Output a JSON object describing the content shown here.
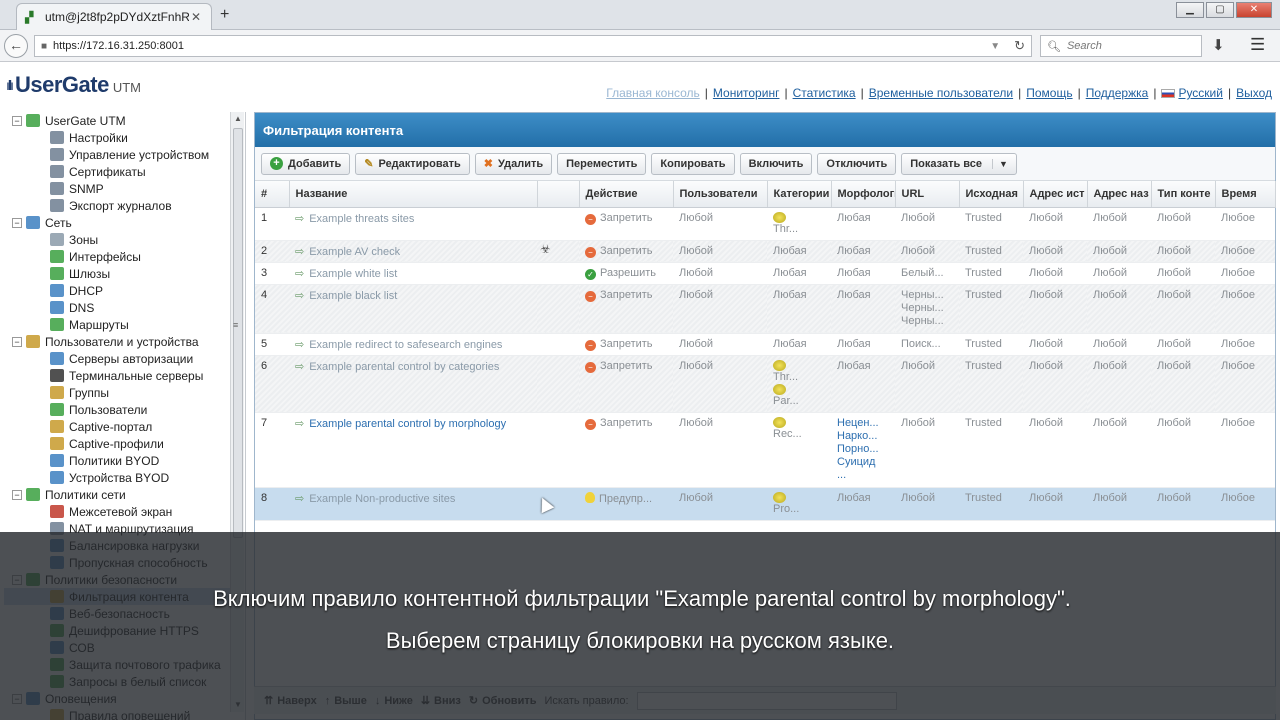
{
  "browser": {
    "tab_title": "utm@j2t8fp2pDYdXztFnhR...",
    "new_tab": "+",
    "url": "https://172.16.31.250:8001",
    "search_placeholder": "Search"
  },
  "app": {
    "brand": "UserGate",
    "brand_sub": "UTM",
    "top_links": [
      "Главная консоль",
      "Мониторинг",
      "Статистика",
      "Временные пользователи",
      "Помощь",
      "Поддержка",
      "Русский",
      "Выход"
    ]
  },
  "sidebar": {
    "items": [
      {
        "label": "UserGate UTM",
        "level": 0,
        "icon": "ug-icon",
        "color": "#3aa040"
      },
      {
        "label": "Настройки",
        "level": 1,
        "icon": "settings-icon",
        "color": "#6d7e90"
      },
      {
        "label": "Управление устройством",
        "level": 1,
        "icon": "device-icon",
        "color": "#6d7e90"
      },
      {
        "label": "Сертификаты",
        "level": 1,
        "icon": "certificate-icon",
        "color": "#6d7e90"
      },
      {
        "label": "SNMP",
        "level": 1,
        "icon": "snmp-icon",
        "color": "#6d7e90"
      },
      {
        "label": "Экспорт журналов",
        "level": 1,
        "icon": "export-icon",
        "color": "#6d7e90"
      },
      {
        "label": "Сеть",
        "level": 0,
        "icon": "network-icon",
        "color": "#3c7fc0"
      },
      {
        "label": "Зоны",
        "level": 1,
        "icon": "zones-icon",
        "color": "#8a9aa8"
      },
      {
        "label": "Интерфейсы",
        "level": 1,
        "icon": "interfaces-icon",
        "color": "#3aa040"
      },
      {
        "label": "Шлюзы",
        "level": 1,
        "icon": "gateways-icon",
        "color": "#3aa040"
      },
      {
        "label": "DHCP",
        "level": 1,
        "icon": "dhcp-icon",
        "color": "#3c7fc0"
      },
      {
        "label": "DNS",
        "level": 1,
        "icon": "dns-icon",
        "color": "#3c7fc0"
      },
      {
        "label": "Маршруты",
        "level": 1,
        "icon": "routes-icon",
        "color": "#3aa040"
      },
      {
        "label": "Пользователи и устройства",
        "level": 0,
        "icon": "users-devices-icon",
        "color": "#c79a2b"
      },
      {
        "label": "Серверы авторизации",
        "level": 1,
        "icon": "auth-servers-icon",
        "color": "#3c7fc0"
      },
      {
        "label": "Терминальные серверы",
        "level": 1,
        "icon": "terminal-servers-icon",
        "color": "#333333"
      },
      {
        "label": "Группы",
        "level": 1,
        "icon": "groups-icon",
        "color": "#c79a2b"
      },
      {
        "label": "Пользователи",
        "level": 1,
        "icon": "users-icon",
        "color": "#3aa040"
      },
      {
        "label": "Captive-портал",
        "level": 1,
        "icon": "captive-portal-icon",
        "color": "#c79a2b"
      },
      {
        "label": "Captive-профили",
        "level": 1,
        "icon": "captive-profiles-icon",
        "color": "#c79a2b"
      },
      {
        "label": "Политики BYOD",
        "level": 1,
        "icon": "byod-policies-icon",
        "color": "#3c7fc0"
      },
      {
        "label": "Устройства BYOD",
        "level": 1,
        "icon": "byod-devices-icon",
        "color": "#3c7fc0"
      },
      {
        "label": "Политики сети",
        "level": 0,
        "icon": "network-policies-icon",
        "color": "#3aa040"
      },
      {
        "label": "Межсетевой экран",
        "level": 1,
        "icon": "firewall-icon",
        "color": "#c0392b"
      },
      {
        "label": "NAT и маршрутизация",
        "level": 1,
        "icon": "nat-icon",
        "color": "#6d7e90"
      },
      {
        "label": "Балансировка нагрузки",
        "level": 1,
        "icon": "load-balancing-icon",
        "color": "#3c7fc0"
      },
      {
        "label": "Пропускная способность",
        "level": 1,
        "icon": "bandwidth-icon",
        "color": "#3c7fc0"
      },
      {
        "label": "Политики безопасности",
        "level": 0,
        "icon": "security-policies-icon",
        "color": "#3aa040"
      },
      {
        "label": "Фильтрация контента",
        "level": 1,
        "icon": "content-filter-icon",
        "color": "#c79a2b",
        "selected": true
      },
      {
        "label": "Веб-безопасность",
        "level": 1,
        "icon": "web-security-icon",
        "color": "#3c7fc0"
      },
      {
        "label": "Дешифрование HTTPS",
        "level": 1,
        "icon": "https-icon",
        "color": "#3aa040"
      },
      {
        "label": "СОВ",
        "level": 1,
        "icon": "ids-icon",
        "color": "#3c7fc0"
      },
      {
        "label": "Защита почтового трафика",
        "level": 1,
        "icon": "mail-protection-icon",
        "color": "#3aa040"
      },
      {
        "label": "Запросы в белый список",
        "level": 1,
        "icon": "whitelist-requests-icon",
        "color": "#3aa040"
      },
      {
        "label": "Оповещения",
        "level": 0,
        "icon": "notifications-icon",
        "color": "#3c7fc0"
      },
      {
        "label": "Правила оповещений",
        "level": 1,
        "icon": "alert-rules-icon",
        "color": "#c79a2b"
      }
    ]
  },
  "panel": {
    "title": "Фильтрация контента",
    "toolbar": [
      {
        "label": "Добавить",
        "icon": "+"
      },
      {
        "label": "Редактировать",
        "icon": "✎"
      },
      {
        "label": "Удалить",
        "icon": "✖"
      },
      {
        "label": "Переместить",
        "icon": ""
      },
      {
        "label": "Копировать",
        "icon": ""
      },
      {
        "label": "Включить",
        "icon": ""
      },
      {
        "label": "Отключить",
        "icon": ""
      },
      {
        "label": "Показать все",
        "icon": "",
        "dropdown": true
      }
    ],
    "columns": [
      "#",
      "Название",
      "",
      "Действие",
      "Пользователи",
      "Категории",
      "Морфология",
      "URL",
      "Исходная",
      "Адрес ист",
      "Адрес наз",
      "Тип конте",
      "Время"
    ],
    "rows": [
      {
        "num": "1",
        "name": "Example threats sites",
        "action": "Запретить",
        "action_type": "deny",
        "users": "Любой",
        "categories": [
          "Thr..."
        ],
        "morph": [
          "Любая"
        ],
        "url": [
          "Любой"
        ],
        "src": "Trusted",
        "src_addr": "Любой",
        "dst_addr": "Любой",
        "ctype": "Любой",
        "time": "Любое"
      },
      {
        "num": "2",
        "name": "Example AV check",
        "action": "Запретить",
        "action_type": "deny",
        "users": "Любой",
        "categories": [
          "Любая"
        ],
        "morph": [
          "Любая"
        ],
        "url": [
          "Любой"
        ],
        "src": "Trusted",
        "src_addr": "Любой",
        "dst_addr": "Любой",
        "ctype": "Любой",
        "time": "Любое"
      },
      {
        "num": "3",
        "name": "Example white list",
        "action": "Разрешить",
        "action_type": "allow",
        "users": "Любой",
        "categories": [
          "Любая"
        ],
        "morph": [
          "Любая"
        ],
        "url": [
          "Белый..."
        ],
        "src": "Trusted",
        "src_addr": "Любой",
        "dst_addr": "Любой",
        "ctype": "Любой",
        "time": "Любое"
      },
      {
        "num": "4",
        "name": "Example black list",
        "action": "Запретить",
        "action_type": "deny",
        "users": "Любой",
        "categories": [
          "Любая"
        ],
        "morph": [
          "Любая"
        ],
        "url": [
          "Черны...",
          "Черны...",
          "Черны..."
        ],
        "src": "Trusted",
        "src_addr": "Любой",
        "dst_addr": "Любой",
        "ctype": "Любой",
        "time": "Любое"
      },
      {
        "num": "5",
        "name": "Example redirect to safesearch engines",
        "action": "Запретить",
        "action_type": "deny",
        "users": "Любой",
        "categories": [
          "Любая"
        ],
        "morph": [
          "Любая"
        ],
        "url": [
          "Поиск..."
        ],
        "src": "Trusted",
        "src_addr": "Любой",
        "dst_addr": "Любой",
        "ctype": "Любой",
        "time": "Любое"
      },
      {
        "num": "6",
        "name": "Example parental control by categories",
        "action": "Запретить",
        "action_type": "deny",
        "users": "Любой",
        "categories": [
          "Thr...",
          "Par..."
        ],
        "morph": [
          "Любая"
        ],
        "url": [
          "Любой"
        ],
        "src": "Trusted",
        "src_addr": "Любой",
        "dst_addr": "Любой",
        "ctype": "Любой",
        "time": "Любое"
      },
      {
        "num": "7",
        "name": "Example parental control by morphology",
        "action": "Запретить",
        "action_type": "deny",
        "users": "Любой",
        "categories": [
          "Rec..."
        ],
        "morph": [
          "Нецен...",
          "Нарко...",
          "Порно...",
          "Суицид",
          "..."
        ],
        "url": [
          "Любой"
        ],
        "src": "Trusted",
        "src_addr": "Любой",
        "dst_addr": "Любой",
        "ctype": "Любой",
        "time": "Любое"
      },
      {
        "num": "8",
        "name": "Example Non-productive sites",
        "action": "Предупр...",
        "action_type": "warn",
        "users": "Любой",
        "categories": [
          "Pro..."
        ],
        "morph": [
          "Любая"
        ],
        "url": [
          "Любой"
        ],
        "src": "Trusted",
        "src_addr": "Любой",
        "dst_addr": "Любой",
        "ctype": "Любой",
        "time": "Любое"
      }
    ]
  },
  "bottombar": {
    "buttons": [
      "Наверх",
      "Выше",
      "Ниже",
      "Вниз",
      "Обновить"
    ],
    "search_label": "Искать правило:"
  },
  "subtitles": {
    "line1": "Включим правило контентной фильтрации \"Example parental control by morphology\".",
    "line2": "Выберем страницу блокировки на русском языке."
  }
}
